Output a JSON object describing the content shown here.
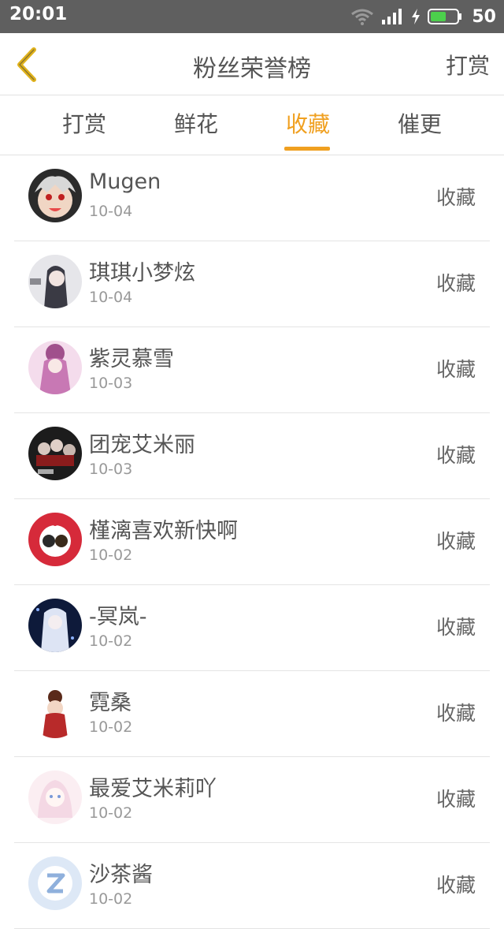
{
  "status_bar": {
    "time": "20:01",
    "battery": "50"
  },
  "header": {
    "title": "粉丝荣誉榜",
    "right_button": "打赏"
  },
  "tabs": [
    {
      "label": "打赏"
    },
    {
      "label": "鲜花"
    },
    {
      "label": "收藏",
      "active": true
    },
    {
      "label": "催更"
    }
  ],
  "colors": {
    "accent": "#f0a020",
    "status_bar": "#5f5f5f"
  },
  "fans": [
    {
      "name": "Mugen",
      "date": "10-04",
      "action": "收藏"
    },
    {
      "name": "琪琪小梦炫",
      "date": "10-04",
      "action": "收藏"
    },
    {
      "name": "紫灵慕雪",
      "date": "10-03",
      "action": "收藏"
    },
    {
      "name": "团宠艾米丽",
      "date": "10-03",
      "action": "收藏"
    },
    {
      "name": "槿漓喜欢新快啊",
      "date": "10-02",
      "action": "收藏"
    },
    {
      "name": "-冥岚-",
      "date": "10-02",
      "action": "收藏"
    },
    {
      "name": "霓桑",
      "date": "10-02",
      "action": "收藏"
    },
    {
      "name": "最爱艾米莉吖",
      "date": "10-02",
      "action": "收藏"
    },
    {
      "name": "沙茶酱",
      "date": "10-02",
      "action": "收藏"
    }
  ]
}
